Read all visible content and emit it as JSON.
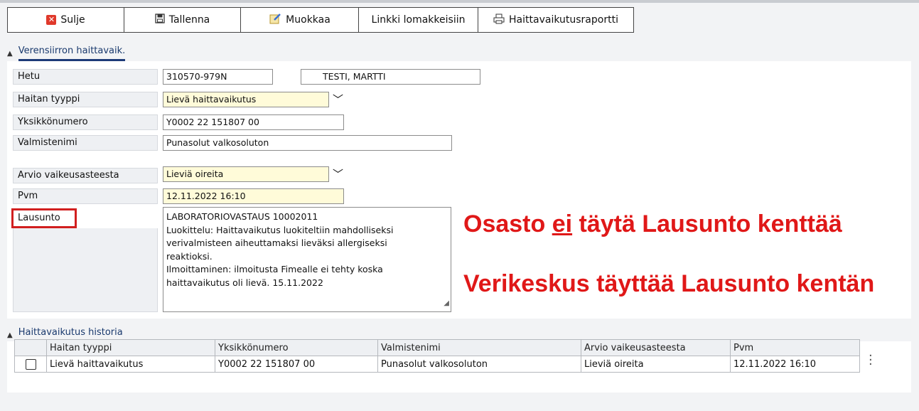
{
  "toolbar": {
    "buttons": [
      {
        "label": "Sulje",
        "icon": "close-x-icon"
      },
      {
        "label": "Tallenna",
        "icon": "save-disk-icon"
      },
      {
        "label": "Muokkaa",
        "icon": "edit-icon"
      },
      {
        "label": "Linkki lomakkeisiin",
        "icon": ""
      },
      {
        "label": "Haittavaikutusraportti",
        "icon": "print-icon"
      }
    ]
  },
  "section1": {
    "title": "Verensiirron haittavaik.",
    "fields": {
      "hetu_label": "Hetu",
      "hetu_value": "310570-979N",
      "name_value": "TESTI, MARTTI",
      "tyyppi_label": "Haitan tyyppi",
      "tyyppi_value": "Lievä haittavaikutus",
      "yksikko_label": "Yksikkönumero",
      "yksikko_value": "Y0002 22 151807 00",
      "valmiste_label": "Valmistenimi",
      "valmiste_value": "Punasolut valkosoluton",
      "arvio_label": "Arvio vaikeusasteesta",
      "arvio_value": "Lieviä oireita",
      "pvm_label": "Pvm",
      "pvm_value": "12.11.2022 16:10",
      "lausunto_label": "Lausunto",
      "lausunto_lines": [
        "LABORATORIOVASTAUS 10002011",
        "Luokittelu: Haittavaikutus luokiteltiin mahdolliseksi",
        "verivalmisteen aiheuttamaksi lieväksi allergiseksi",
        "reaktioksi.",
        "Ilmoittaminen: ilmoitusta Fimealle ei tehty koska",
        "haittavaikutus oli lievä. 15.11.2022"
      ]
    }
  },
  "annotations": {
    "note1_pre": "Osasto ",
    "note1_emph": "ei",
    "note1_post": " täytä Lausunto kenttää",
    "note2": "Verikeskus täyttää Lausunto kentän"
  },
  "section2": {
    "title": "Haittavaikutus historia",
    "columns": [
      "Haitan tyyppi",
      "Yksikkönumero",
      "Valmistenimi",
      "Arvio vaikeusasteesta",
      "Pvm"
    ],
    "rows": [
      [
        "Lievä haittavaikutus",
        "Y0002 22 151807 00",
        "Punasolut valkosoluton",
        "Lieviä oireita",
        "12.11.2022 16:10"
      ]
    ]
  },
  "colors": {
    "accent": "#1d3a78",
    "highlight_red": "#e01818",
    "required_yellow": "#fffbd9"
  }
}
